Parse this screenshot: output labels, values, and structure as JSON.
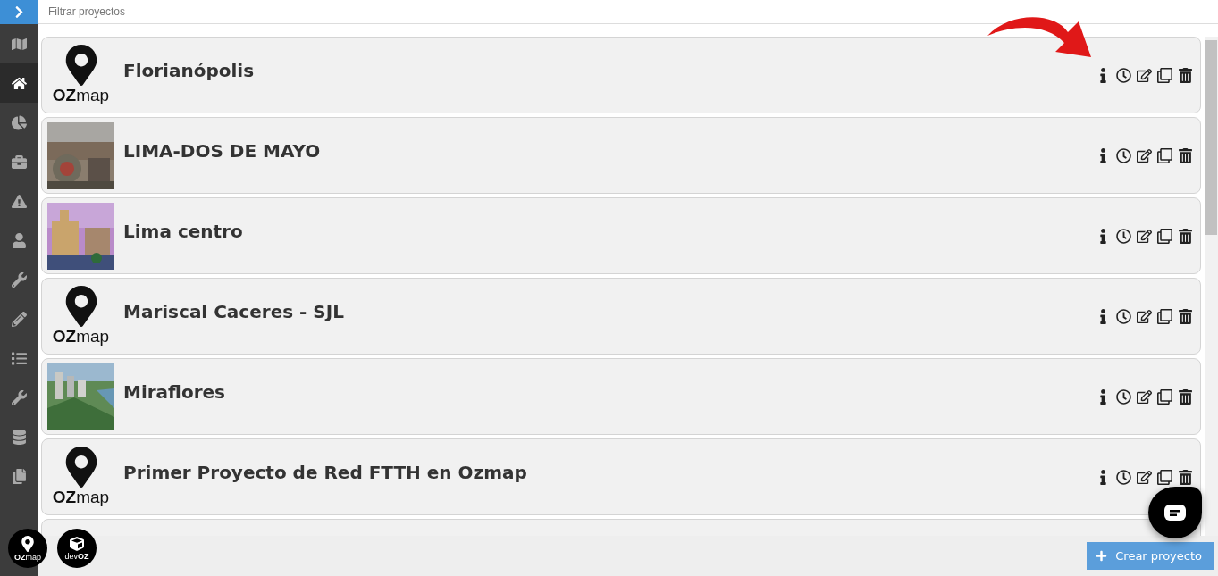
{
  "sidebar": {
    "items": [
      {
        "selected": false
      },
      {
        "selected": true
      },
      {
        "selected": false
      },
      {
        "selected": false
      },
      {
        "selected": false
      },
      {
        "selected": false
      },
      {
        "selected": false
      },
      {
        "selected": false
      },
      {
        "selected": false
      },
      {
        "selected": false
      },
      {
        "selected": false
      },
      {
        "selected": false
      }
    ],
    "apps": [
      {
        "kind": "ozmap",
        "label_bold": "OZ",
        "label_rest": "map"
      },
      {
        "kind": "devoz",
        "label_bold": "OZ",
        "label_rest": "dev"
      }
    ]
  },
  "search": {
    "placeholder": "Filtrar proyectos"
  },
  "projects": [
    {
      "name": "Florianópolis",
      "kind": "logo",
      "logo_bold": "OZ",
      "logo_rest": "map"
    },
    {
      "name": "LIMA-DOS DE MAYO",
      "kind": "picture"
    },
    {
      "name": "Lima centro",
      "kind": "picture"
    },
    {
      "name": "Mariscal Caceres - SJL",
      "kind": "logo",
      "logo_bold": "OZ",
      "logo_rest": "map"
    },
    {
      "name": "Miraflores",
      "kind": "picture"
    },
    {
      "name": "Primer Proyecto de Red FTTH en Ozmap",
      "kind": "logo",
      "logo_bold": "OZ",
      "logo_rest": "map"
    },
    {
      "kind": "partial"
    }
  ],
  "create_button": {
    "label": "Crear proyecto"
  }
}
